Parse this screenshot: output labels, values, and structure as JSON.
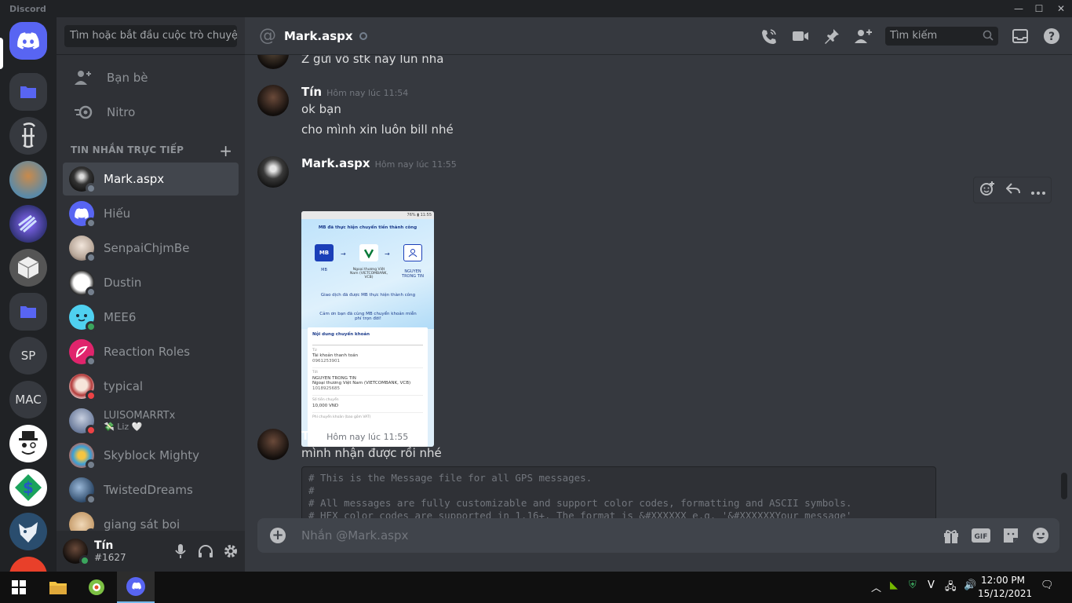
{
  "app": {
    "title": "Discord"
  },
  "window": {
    "minimize": "—",
    "maximize": "☐",
    "close": "✕"
  },
  "guilds": [
    {
      "name": "home",
      "label": ""
    },
    {
      "name": "folder-1",
      "label": ""
    },
    {
      "name": "server-2",
      "label": ""
    },
    {
      "name": "server-3",
      "label": ""
    },
    {
      "name": "server-4",
      "label": ""
    },
    {
      "name": "server-5",
      "label": ""
    },
    {
      "name": "folder-2",
      "label": ""
    },
    {
      "name": "server-sp",
      "label": "SP"
    },
    {
      "name": "server-mac",
      "label": "MAC"
    }
  ],
  "sidebar": {
    "search_placeholder": "Tìm hoặc bắt đầu cuộc trò chuyện",
    "friends_label": "Bạn bè",
    "nitro_label": "Nitro",
    "dm_header": "TIN NHẮN TRỰC TIẾP",
    "dm_add": "+",
    "dms": [
      {
        "name": "Mark.aspx",
        "status": "offline",
        "active": true
      },
      {
        "name": "Hiếu",
        "status": "offline"
      },
      {
        "name": "SenpaiChjmBe",
        "status": "offline"
      },
      {
        "name": "Dustin",
        "status": "offline"
      },
      {
        "name": "MEE6",
        "status": "online"
      },
      {
        "name": "Reaction Roles",
        "status": "offline"
      },
      {
        "name": "typical",
        "status": "dnd"
      },
      {
        "name": "LUISOMARRTx",
        "sub": "💸 Liz 🤍",
        "status": "dnd"
      },
      {
        "name": "Skyblock Mighty",
        "status": "offline"
      },
      {
        "name": "TwistedDreams",
        "status": "offline"
      },
      {
        "name": "giang sát boi",
        "status": "offline"
      }
    ]
  },
  "user": {
    "name": "Tín",
    "tag": "#1627"
  },
  "channel": {
    "title": "Mark.aspx",
    "search_placeholder": "Tìm kiếm",
    "composer_placeholder": "Nhắn @Mark.aspx"
  },
  "messages": {
    "cut_text": "Z gửi vô stk này lun nha",
    "m1": {
      "author": "Tín",
      "time": "Hôm nay lúc 11:54",
      "lines": [
        "ok bạn",
        "cho mình xin luôn bill nhé"
      ]
    },
    "m2": {
      "author": "Mark.aspx",
      "time": "Hôm nay lúc 11:55"
    },
    "m3": {
      "author": "Tín",
      "time": "Hôm nay lúc 11:55",
      "lines": [
        "mình nhận được rồi nhé"
      ]
    },
    "code": "# This is the Message file for all GPS messages.\n#\n# All messages are fully customizable and support color codes, formatting and ASCII symbols.\n# HEX color codes are supported in 1.16+. The format is &#XXXXXX e.g. '&#XXXXXXYour message'"
  },
  "receipt": {
    "status": "76% ▮ 11:55",
    "headline": "MB đã thực hiện chuyển tiền thành công",
    "from": "MB",
    "bank": "Ngoại thương Việt Nam (VIETCOMBANK, VCB)",
    "to": "NGUYEN TRONG TIN",
    "success_text": "Giao dịch đã được MB thực hiện thành công",
    "thanks_text": "Cảm ơn bạn đã cùng MB chuyển khoản miễn phí trọn đời!",
    "section_title": "Nội dung chuyển khoản",
    "from_label": "Từ",
    "from_account_name": "Tài khoản thanh toán",
    "from_account_no": "0961253901",
    "to_label": "Tới",
    "to_name": "NGUYEN TRONG TIN",
    "to_bank": "Ngoại thương Việt Nam (VIETCOMBANK, VCB)",
    "to_account_no": "1018925685",
    "amount_label": "Số tiền chuyển",
    "amount": "10,000 VND",
    "fee_label": "Phí chuyển khoản (bao gồm VAT)"
  },
  "taskbar": {
    "time": "12:00 PM",
    "date": "15/12/2021"
  }
}
